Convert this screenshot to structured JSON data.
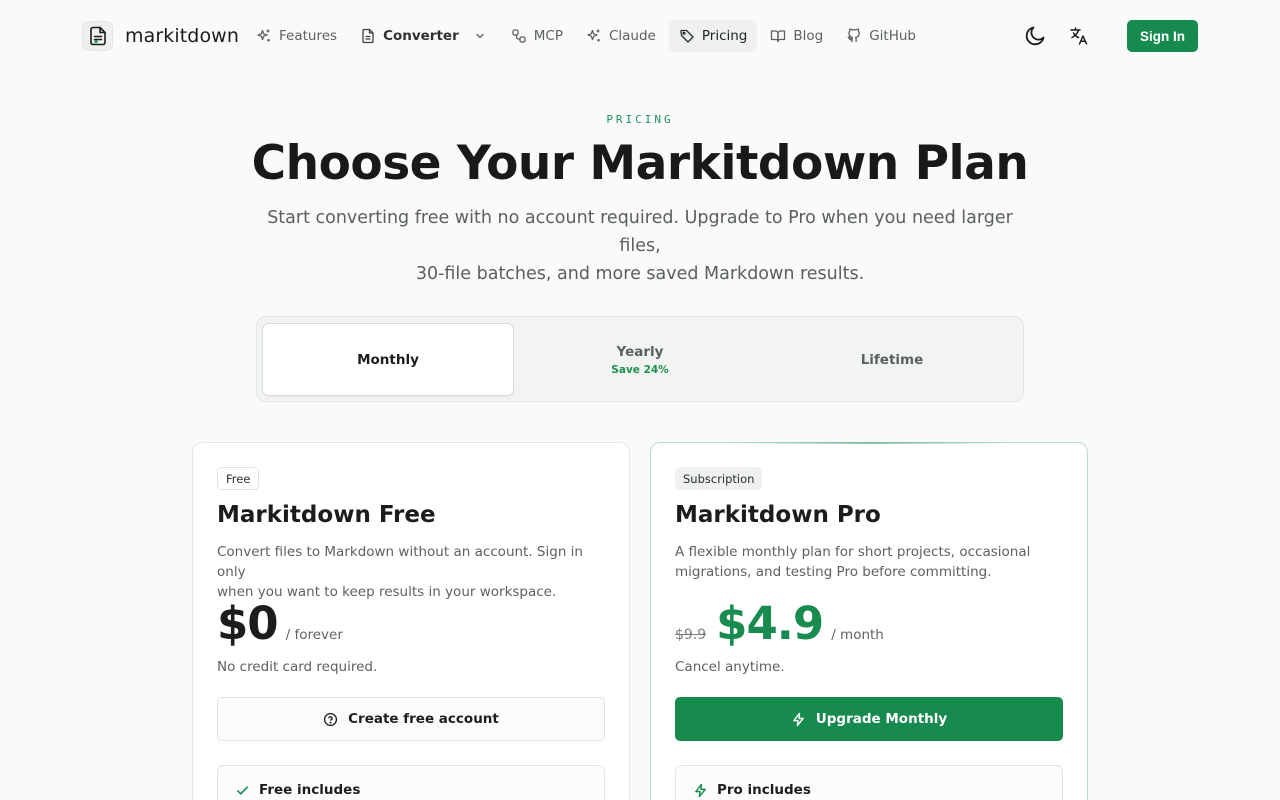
{
  "brand": {
    "name": "markitdown"
  },
  "nav": {
    "items": [
      {
        "label": "Features",
        "icon": "sparkles-icon"
      },
      {
        "label": "Converter",
        "icon": "file-icon",
        "has_dropdown": true
      },
      {
        "label": "MCP",
        "icon": "link-nodes-icon"
      },
      {
        "label": "Claude",
        "icon": "sparkles-icon"
      },
      {
        "label": "Pricing",
        "icon": "tag-icon",
        "active": true
      },
      {
        "label": "Blog",
        "icon": "book-icon"
      },
      {
        "label": "GitHub",
        "icon": "github-icon"
      }
    ],
    "theme_icon": "moon-icon",
    "language_icon": "translate-icon",
    "sign_in": "Sign In"
  },
  "hero": {
    "eyebrow": "PRICING",
    "title": "Choose Your Markitdown Plan",
    "subtitle_line1": "Start converting free with no account required. Upgrade to Pro when you need larger files,",
    "subtitle_line2": "30-file batches, and more saved Markdown results."
  },
  "billing": {
    "options": [
      {
        "label": "Monthly",
        "selected": true
      },
      {
        "label": "Yearly",
        "note": "Save 24%"
      },
      {
        "label": "Lifetime"
      }
    ]
  },
  "plans": {
    "free": {
      "badge": "Free",
      "name": "Markitdown Free",
      "desc_line1": "Convert files to Markdown without an account. Sign in only",
      "desc_line2": "when you want to keep results in your workspace.",
      "price": "$0",
      "period": "/ forever",
      "note": "No credit card required.",
      "cta": "Create free account",
      "cta_icon": "help-circle-icon",
      "includes": "Free includes",
      "includes_icon": "check-icon"
    },
    "pro": {
      "badge": "Subscription",
      "name": "Markitdown Pro",
      "desc_line1": "A flexible monthly plan for short projects, occasional",
      "desc_line2": "migrations, and testing Pro before committing.",
      "old_price": "$9.9",
      "price": "$4.9",
      "period": "/ month",
      "note": "Cancel anytime.",
      "cta": "Upgrade Monthly",
      "cta_icon": "lightning-icon",
      "includes": "Pro includes",
      "includes_icon": "lightning-icon"
    }
  },
  "colors": {
    "accent": "#178a4f",
    "background": "#f9faf9",
    "text": "#1a1d1b",
    "muted": "#5c625e"
  }
}
